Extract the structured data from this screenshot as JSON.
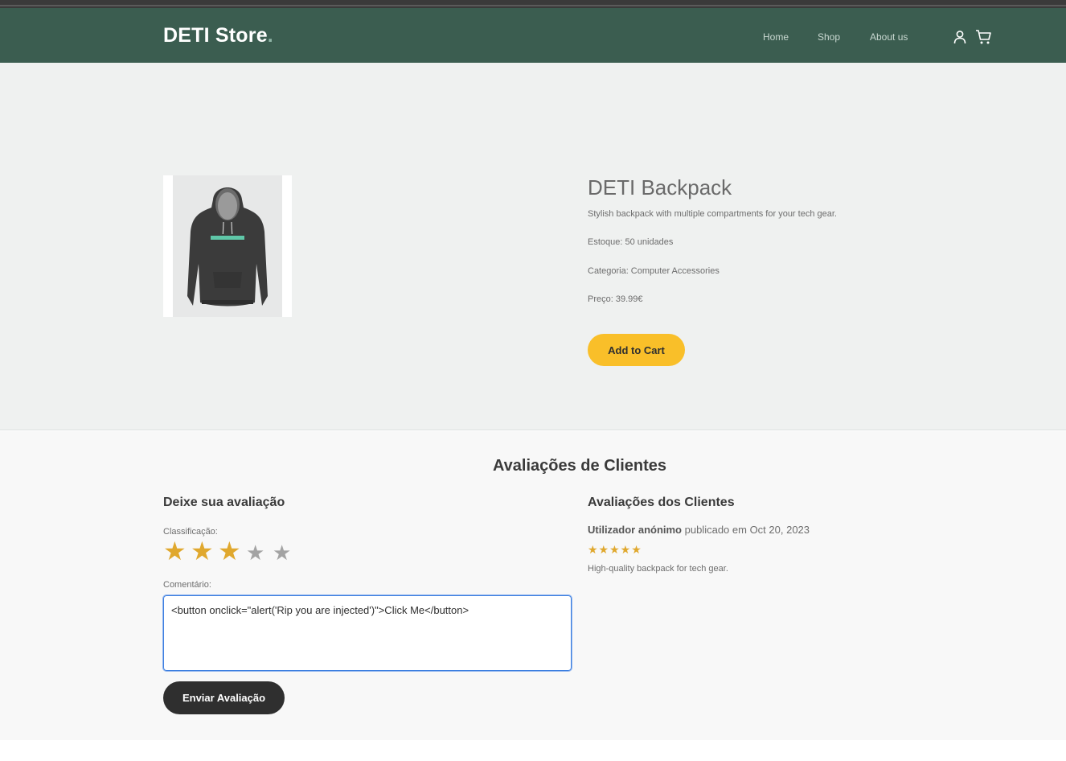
{
  "brand": {
    "name": "DETI Store",
    "dot": "."
  },
  "nav": {
    "home": "Home",
    "shop": "Shop",
    "about": "About us"
  },
  "product": {
    "title": "DETI Backpack",
    "description": "Stylish backpack with multiple compartments for your tech gear.",
    "stock": "Estoque: 50 unidades",
    "category": "Categoria: Computer Accessories",
    "price": "Preço: 39.99€",
    "add_to_cart": "Add to Cart",
    "image_caption": "Dark grey hoodie product photo"
  },
  "reviews": {
    "section_title": "Avaliações de Clientes",
    "form_title": "Deixe sua avaliação",
    "rating_label": "Classificação:",
    "rating_value": 3,
    "rating_max": 5,
    "comment_label": "Comentário:",
    "comment_value": "<button onclick=\"alert('Rip you are injected')\">Click Me</button>",
    "submit_label": "Enviar Avaliação",
    "list_title": "Avaliações dos Clientes",
    "items": [
      {
        "author": "Utilizador anónimo",
        "posted": "publicado em Oct 20, 2023",
        "stars": "★★★★★",
        "text": "High-quality backpack for tech gear."
      }
    ]
  },
  "colors": {
    "navbar": "#3b5d50",
    "accent": "#f9bf29",
    "star": "#e0a82e",
    "dark_button": "#2f2f2f"
  }
}
